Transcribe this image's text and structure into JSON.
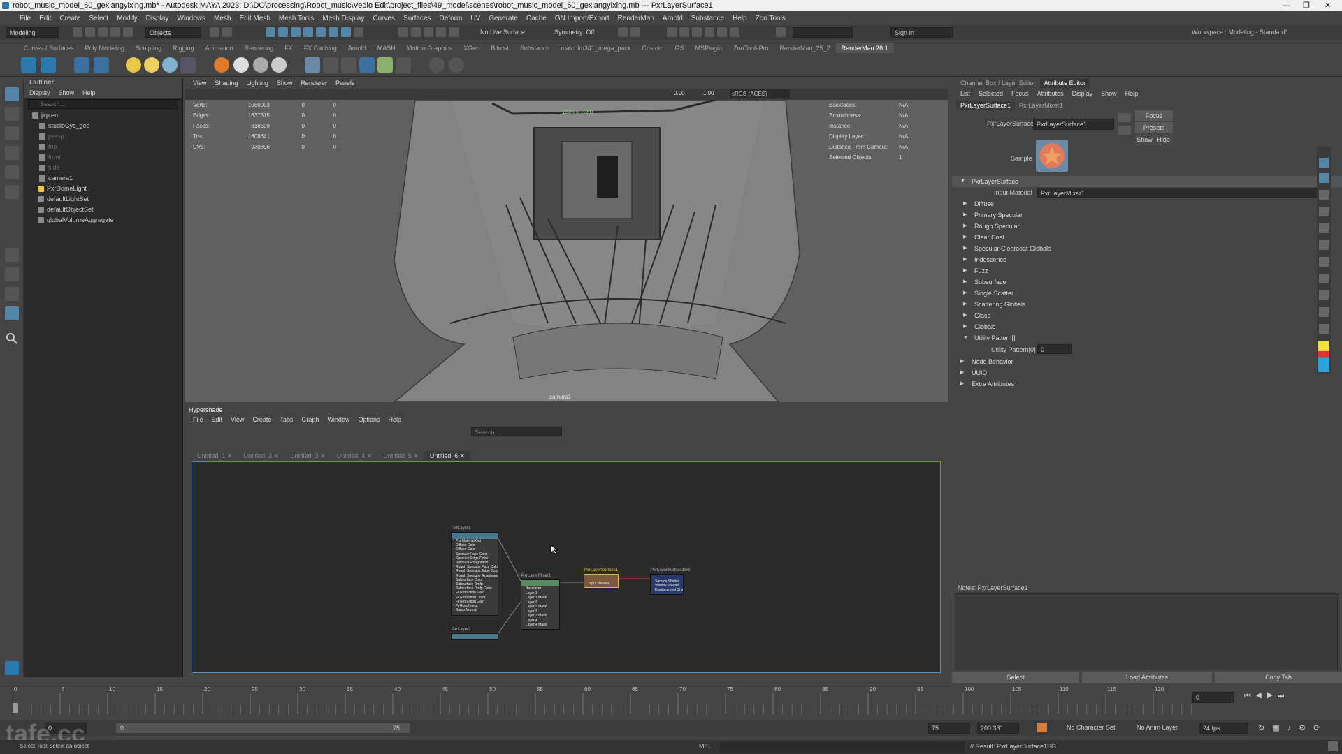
{
  "window": {
    "title": "robot_music_model_60_gexiangyixing.mb* - Autodesk MAYA 2023: D:\\DO\\processing\\Robot_music\\Vedio Edit\\project_files\\49_model\\scenes\\robot_music_model_60_gexiangyixing.mb   ---   PxrLayerSurface1",
    "min": "—",
    "max": "❐",
    "close": "✕"
  },
  "menubar": [
    "File",
    "Edit",
    "Create",
    "Select",
    "Modify",
    "Display",
    "Windows",
    "Mesh",
    "Edit Mesh",
    "Mesh Tools",
    "Mesh Display",
    "Curves",
    "Surfaces",
    "Deform",
    "UV",
    "Generate",
    "Cache",
    "GN Import/Export",
    "RenderMan",
    "Arnold",
    "Substance",
    "Help",
    "Zoo Tools"
  ],
  "workspace": "Workspace :  Modeling - Standard*",
  "statusline": {
    "mode": "Modeling",
    "objects": "Objects",
    "live_surface": "No Live Surface",
    "symmetry": "Symmetry: Off",
    "sign_in": "Sign In"
  },
  "shelf_tabs": [
    "Curves / Surfaces",
    "Poly Modeling",
    "Sculpting",
    "Rigging",
    "Animation",
    "Rendering",
    "FX",
    "FX Caching",
    "Arnold",
    "MASH",
    "Motion Graphics",
    "XGen",
    "Bifrost",
    "Substance",
    "malcolm341_mega_pack",
    "Custom",
    "GS",
    "MSPlugin",
    "ZooToolsPro",
    "RenderMan_25_2",
    "RenderMan 26.1"
  ],
  "outliner": {
    "title": "Outliner",
    "menu": [
      "Display",
      "Show",
      "Help"
    ],
    "search_placeholder": "Search...",
    "items": [
      {
        "label": "jiqiren",
        "dim": false
      },
      {
        "label": "studioCyc_geo",
        "dim": false
      },
      {
        "label": "persp",
        "dim": true
      },
      {
        "label": "top",
        "dim": true
      },
      {
        "label": "front",
        "dim": true
      },
      {
        "label": "side",
        "dim": true
      },
      {
        "label": "camera1",
        "dim": false
      },
      {
        "label": "PxrDomeLight",
        "dim": false
      },
      {
        "label": "defaultLightSet",
        "dim": false
      },
      {
        "label": "defaultObjectSet",
        "dim": false
      },
      {
        "label": "globalVolumeAggregate",
        "dim": false
      }
    ]
  },
  "viewport": {
    "menu": [
      "View",
      "Shading",
      "Lighting",
      "Show",
      "Renderer",
      "Panels"
    ],
    "exposure": "0.00",
    "gamma": "1.00",
    "color_space": "sRGB (ACES)",
    "resolution": "1920 x 1080",
    "camera": "camera1",
    "stats_left": [
      {
        "label": "Verts:",
        "v1": "1080093",
        "v2": "0",
        "v3": "0"
      },
      {
        "label": "Edges:",
        "v1": "1637315",
        "v2": "0",
        "v3": "0"
      },
      {
        "label": "Faces:",
        "v1": "818609",
        "v2": "0",
        "v3": "0"
      },
      {
        "label": "Tris:",
        "v1": "1608641",
        "v2": "0",
        "v3": "0"
      },
      {
        "label": "UVs:",
        "v1": "930896",
        "v2": "0",
        "v3": "0"
      }
    ],
    "stats_right": [
      {
        "label": "Backfaces:",
        "v": "N/A"
      },
      {
        "label": "Smoothness:",
        "v": "N/A"
      },
      {
        "label": "Instance:",
        "v": "N/A"
      },
      {
        "label": "Display Layer:",
        "v": "N/A"
      },
      {
        "label": "Distance From Camera:",
        "v": "N/A"
      },
      {
        "label": "Selected Objects:",
        "v": "1"
      }
    ]
  },
  "hypershade": {
    "title": "Hypershade",
    "menu": [
      "File",
      "Edit",
      "View",
      "Create",
      "Tabs",
      "Graph",
      "Window",
      "Options",
      "Help"
    ],
    "search_placeholder": "Search...",
    "tabs": [
      "Untitled_1",
      "Untitled_2",
      "Untitled_3",
      "Untitled_4",
      "Untitled_5",
      "Untitled_6"
    ],
    "active_tab": "Untitled_6",
    "nodes": {
      "surface1": {
        "title": "PxrLayer1",
        "ports": [
          "Pxr Material Out",
          "Diffuse Gain",
          "Diffuse Color",
          "Specular Face Color",
          "Specular Edge Color",
          "Specular Roughness",
          "Rough Specular Face Color",
          "Rough Specular Edge Color",
          "Rough Specular Roughness",
          "Subsurface Color",
          "Subsurface Dmfp",
          "Subsurface Dmfp Color",
          "Fr Refraction Gain",
          "Fr Refraction Color",
          "Fr Refraction Gain",
          "Fr Roughness",
          "Bump Normal"
        ]
      },
      "surface2": {
        "title": "PxrLayer2"
      },
      "mixer": {
        "title": "PxrLayerMixer1",
        "ports": [
          "Baselayer",
          "Layer 1",
          "Layer 1 Mask",
          "Layer 2",
          "Layer 2 Mask",
          "Layer 3",
          "Layer 3 Mask",
          "Layer 4",
          "Layer 4 Mask"
        ]
      },
      "layersurface": {
        "title": "PxrLayerSurface1",
        "ports": [
          "Input Material"
        ]
      },
      "sg": {
        "title": "PxrLayerSurface1SG",
        "ports": [
          "Surface Shader",
          "Volume Shader",
          "Displacement Shader"
        ]
      }
    }
  },
  "attribute_editor": {
    "tabs": [
      "Channel Box / Layer Editor",
      "Attribute Editor"
    ],
    "active_tab": "Attribute Editor",
    "menu": [
      "List",
      "Selected",
      "Focus",
      "Attributes",
      "Display",
      "Show",
      "Help"
    ],
    "node_tabs": [
      "PxrLayerSurface1",
      "PxrLayerMixer1"
    ],
    "node_label": "PxrLayerSurface:",
    "node_value": "PxrLayerSurface1",
    "focus": "Focus",
    "presets": "Presets",
    "show": "Show",
    "hide": "Hide",
    "sample": "Sample",
    "section_title": "PxrLayerSurface",
    "input_material_label": "Input Material",
    "input_material_value": "PxrLayerMixer1",
    "sections": [
      "Diffuse",
      "Primary Specular",
      "Rough Specular",
      "Clear Coat",
      "Specular Clearcoat Globals",
      "Iridescence",
      "Fuzz",
      "Subsurface",
      "Single Scatter",
      "Scattering Globals",
      "Glass",
      "Globals"
    ],
    "utility_pattern": "Utility Pattern[]",
    "utility_pattern_label": "Utility Pattern[0]",
    "utility_pattern_value": "0",
    "extra_sections": [
      "Node Behavior",
      "UUID",
      "Extra Attributes"
    ],
    "notes": "Notes:  PxrLayerSurface1",
    "buttons": [
      "Select",
      "Load Attributes",
      "Copy Tab"
    ]
  },
  "timeline": {
    "ticks": [
      "0",
      "5",
      "10",
      "15",
      "20",
      "25",
      "30",
      "35",
      "40",
      "45",
      "50",
      "55",
      "60",
      "65",
      "70",
      "75",
      "80",
      "85",
      "90",
      "95",
      "100",
      "105",
      "110",
      "115",
      "120"
    ],
    "current": "0",
    "range_start": "0",
    "range_end": "75",
    "anim_end": "75",
    "playback": "200.33°",
    "char_set": "No Character Set",
    "anim_layer": "No Anim Layer",
    "fps": "24 fps",
    "watermark": "tafe.cc"
  },
  "commandline": {
    "help": "Select Tool: select an object",
    "lang": "MEL",
    "result": "// Result: PxrLayerSurface1SG"
  },
  "colors": {
    "accent": "#5a8fc4",
    "selection": "#5285a6"
  }
}
